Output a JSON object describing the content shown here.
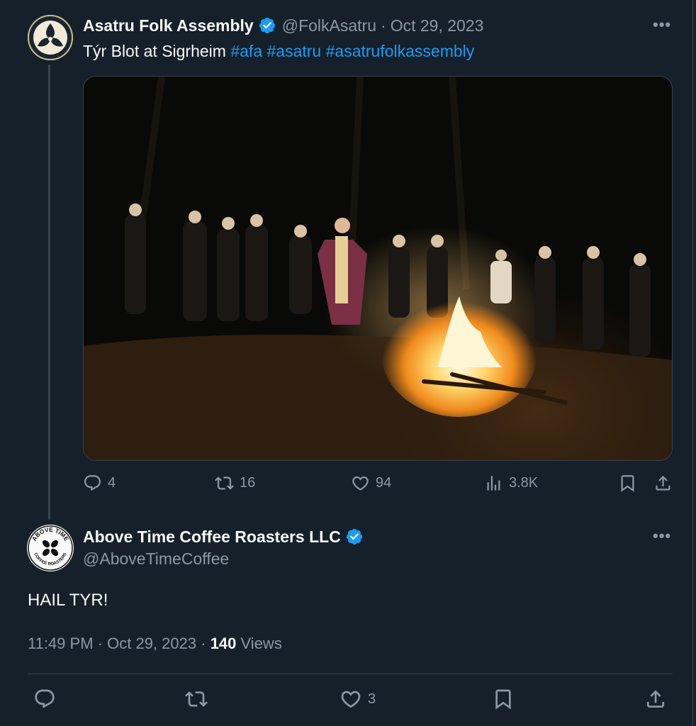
{
  "parent_tweet": {
    "author_name": "Asatru Folk Assembly",
    "handle": "@FolkAsatru",
    "separator": "·",
    "date": "Oct 29, 2023",
    "text_plain": "Týr Blot at Sigrheim",
    "hashtags": [
      "#afa",
      "#asatru",
      "#asatrufolkassembly"
    ],
    "media_icon": "photo-bonfire",
    "stats": {
      "replies": "4",
      "retweets": "16",
      "likes": "94",
      "views": "3.8K"
    }
  },
  "reply_tweet": {
    "author_name": "Above Time Coffee Roasters LLC",
    "handle": "@AboveTimeCoffee",
    "avatar_text_top": "ABOVE TIME",
    "avatar_text_bottom": "COFFEE ROASTERS",
    "text": "HAIL TYR!",
    "time": "11:49 PM",
    "separator": "·",
    "date": "Oct 29, 2023",
    "separator2": "·",
    "views_count": "140",
    "views_label": "Views",
    "stats": {
      "likes": "3"
    }
  },
  "icons": {
    "more": "more-icon",
    "verified": "verified-badge-icon",
    "reply": "reply-icon",
    "retweet": "retweet-icon",
    "like": "like-icon",
    "views": "views-icon",
    "bookmark": "bookmark-icon",
    "share": "share-icon"
  },
  "colors": {
    "background": "#15202b",
    "accent": "#1d9bf0",
    "text_primary": "#f7f9f9",
    "text_secondary": "#8b98a5",
    "border": "#38444d"
  },
  "more_glyph": "•••"
}
